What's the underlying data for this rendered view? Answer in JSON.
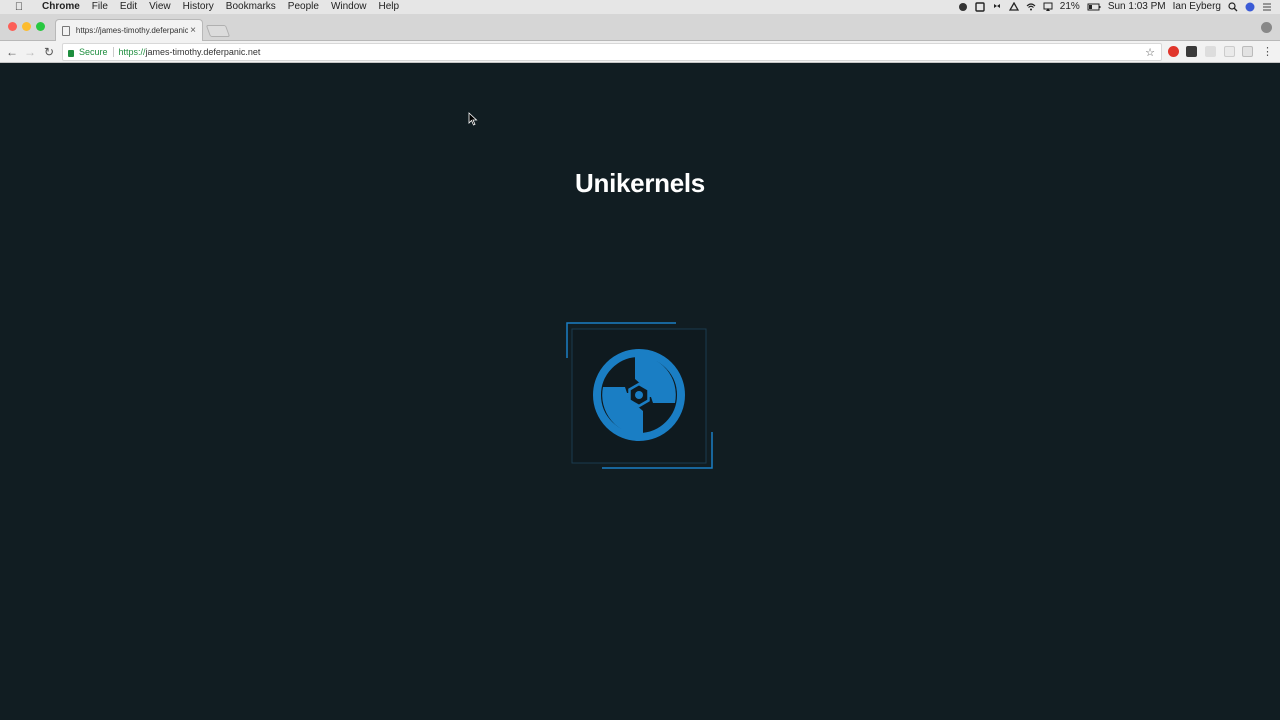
{
  "menubar": {
    "app_name": "Chrome",
    "items": [
      "File",
      "Edit",
      "View",
      "History",
      "Bookmarks",
      "People",
      "Window",
      "Help"
    ],
    "battery": "21%",
    "clock": "Sun 1:03 PM",
    "user": "Ian Eyberg",
    "tray_icons": [
      "creative-cloud-icon",
      "pocket-icon",
      "dropbox-icon",
      "drive-icon",
      "wifi-icon",
      "airplay-icon",
      "battery-icon",
      "spotlight-icon",
      "siri-icon",
      "notification-center-icon"
    ]
  },
  "tab": {
    "title": "https://james-timothy.deferpanic.net",
    "close": "×"
  },
  "toolbar": {
    "back": "←",
    "forward": "→",
    "reload": "↻",
    "secure_label": "Secure",
    "url_scheme": "https://",
    "url_rest": "james-timothy.deferpanic.net",
    "star": "☆",
    "menu": "⋮"
  },
  "page": {
    "title": "Unikernels",
    "logo_icon": "deferpanic-logo-icon",
    "accent_color": "#1a7ec4",
    "background_color": "#111d22"
  }
}
